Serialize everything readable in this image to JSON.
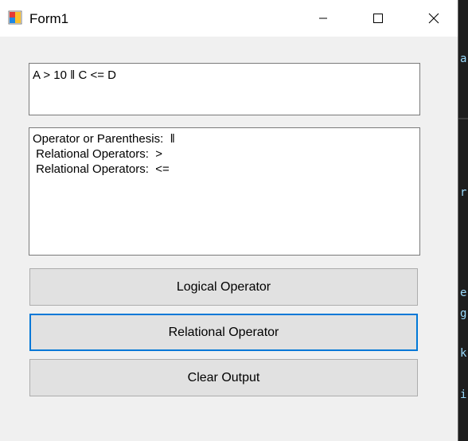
{
  "window": {
    "title": "Form1"
  },
  "input": {
    "text": "A > 10 ‖ C <= D"
  },
  "output": {
    "lines": [
      "Operator or Parenthesis:  ‖",
      " Relational Operators:  >",
      " Relational Operators:  <="
    ]
  },
  "buttons": {
    "logical": "Logical Operator",
    "relational": "Relational Operator",
    "clear": "Clear Output"
  },
  "background": {
    "marks": [
      "a",
      "r",
      "e",
      "g",
      "k",
      "i"
    ]
  }
}
